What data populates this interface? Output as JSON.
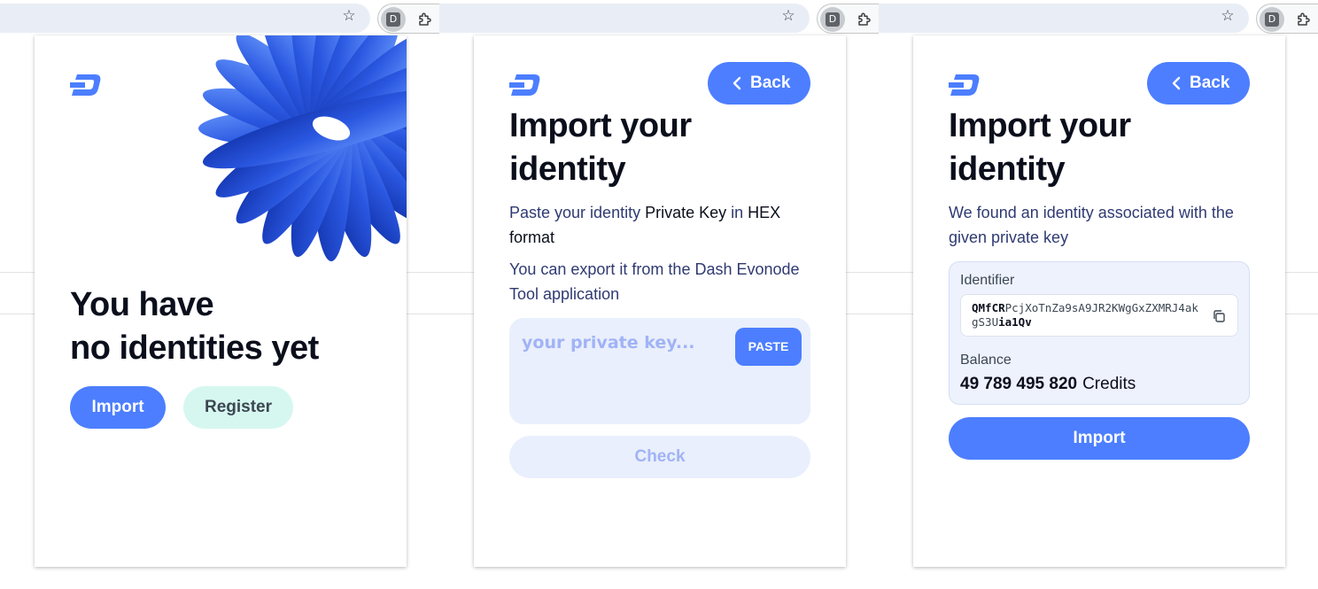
{
  "colors": {
    "accent": "#4c7eff",
    "accent_light": "#e9effc",
    "register_bg": "#d6f7f0",
    "text_dark": "#0b0f1c",
    "text_blue": "#2f3a72"
  },
  "browser": {
    "extension_letter": "D"
  },
  "screen1": {
    "headline_line1": "You have",
    "headline_line2": "no identities yet",
    "import_label": "Import",
    "register_label": "Register"
  },
  "screen2": {
    "back_label": "Back",
    "headline_line1": "Import your",
    "headline_line2": "identity",
    "desc1_part1": "Paste your identity ",
    "desc1_part2": "Private Key",
    "desc1_part3": " in ",
    "desc1_part4": "HEX",
    "desc1_part5": "format",
    "desc2": "You can export it from the Dash Evonode Tool application",
    "key_placeholder": "your private key...",
    "paste_label": "PASTE",
    "check_label": "Check"
  },
  "screen3": {
    "back_label": "Back",
    "headline_line1": "Import your",
    "headline_line2": "identity",
    "found_text": "We found an identity associated with the given private key",
    "identifier_label": "Identifier",
    "identifier_prefix": "QMfCR",
    "identifier_middle": "PcjXoTnZa9sA9JR2KWgGxZXMRJ4akgS3U",
    "identifier_suffix": "ia1Qv",
    "balance_label": "Balance",
    "balance_amount": "49 789 495 820",
    "balance_unit": "Credits",
    "import_label": "Import"
  }
}
